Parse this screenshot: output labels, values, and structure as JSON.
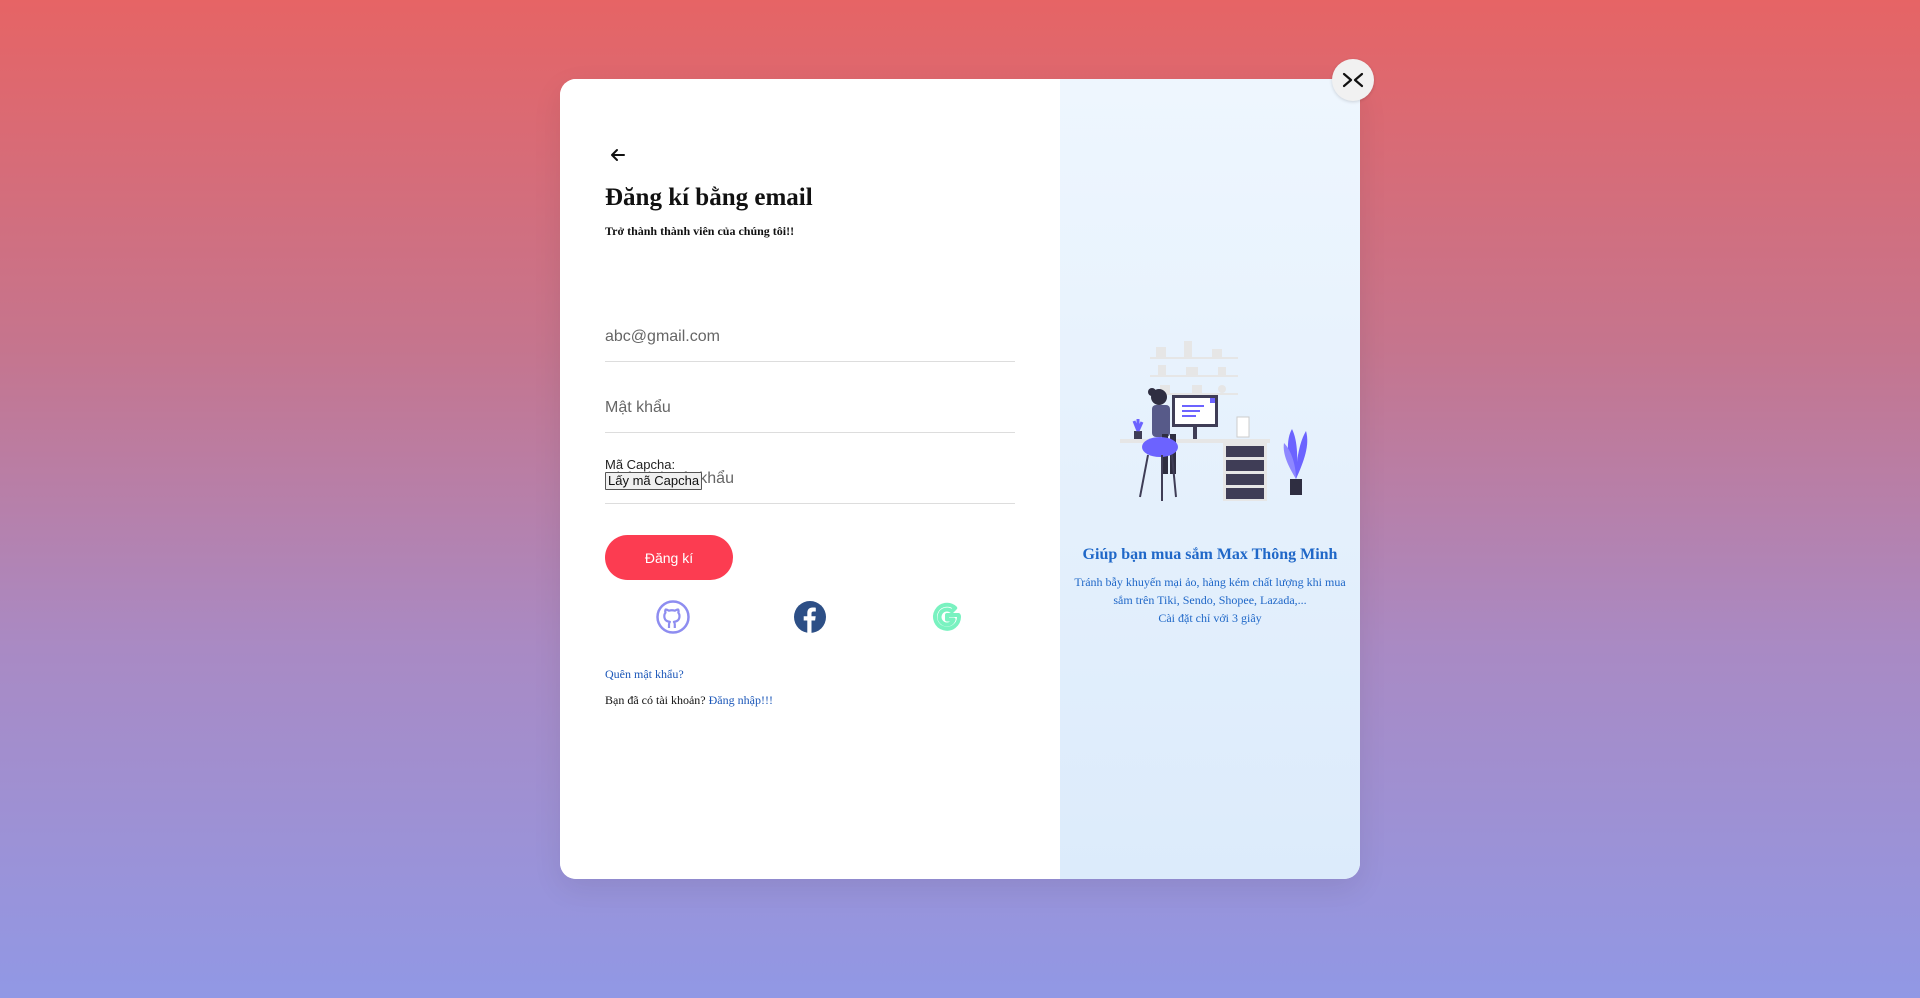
{
  "form": {
    "title": "Đăng kí bằng email",
    "subtitle": "Trở thành thành viên của chúng tôi!!",
    "email_placeholder": "abc@gmail.com",
    "password_placeholder": "Mật khẩu",
    "confirm_password_placeholder": "Nhập lại mật khẩu",
    "captcha_label": "Mã Capcha:",
    "captcha_button": "Lấy mã Capcha",
    "submit_label": "Đăng kí",
    "forgot_password": "Quên mật khẩu?",
    "have_account": "Bạn đã có tài khoản?",
    "login_link": "Đăng nhập!!!"
  },
  "social": {
    "icons": [
      "github-icon",
      "facebook-icon",
      "google-icon"
    ]
  },
  "promo": {
    "title": "Giúp bạn mua sắm Max Thông Minh",
    "line1": "Tránh bẫy khuyến mại ảo, hàng kém chất lượng khi mua",
    "line2": "sắm trên Tiki, Sendo, Shopee, Lazada,...",
    "line3": "Cài đặt chỉ với 3 giây"
  },
  "colors": {
    "accent": "#fc3c51",
    "link": "#1a56b8",
    "promo_text": "#2068c8",
    "illustration_purple": "#6c63ff"
  }
}
